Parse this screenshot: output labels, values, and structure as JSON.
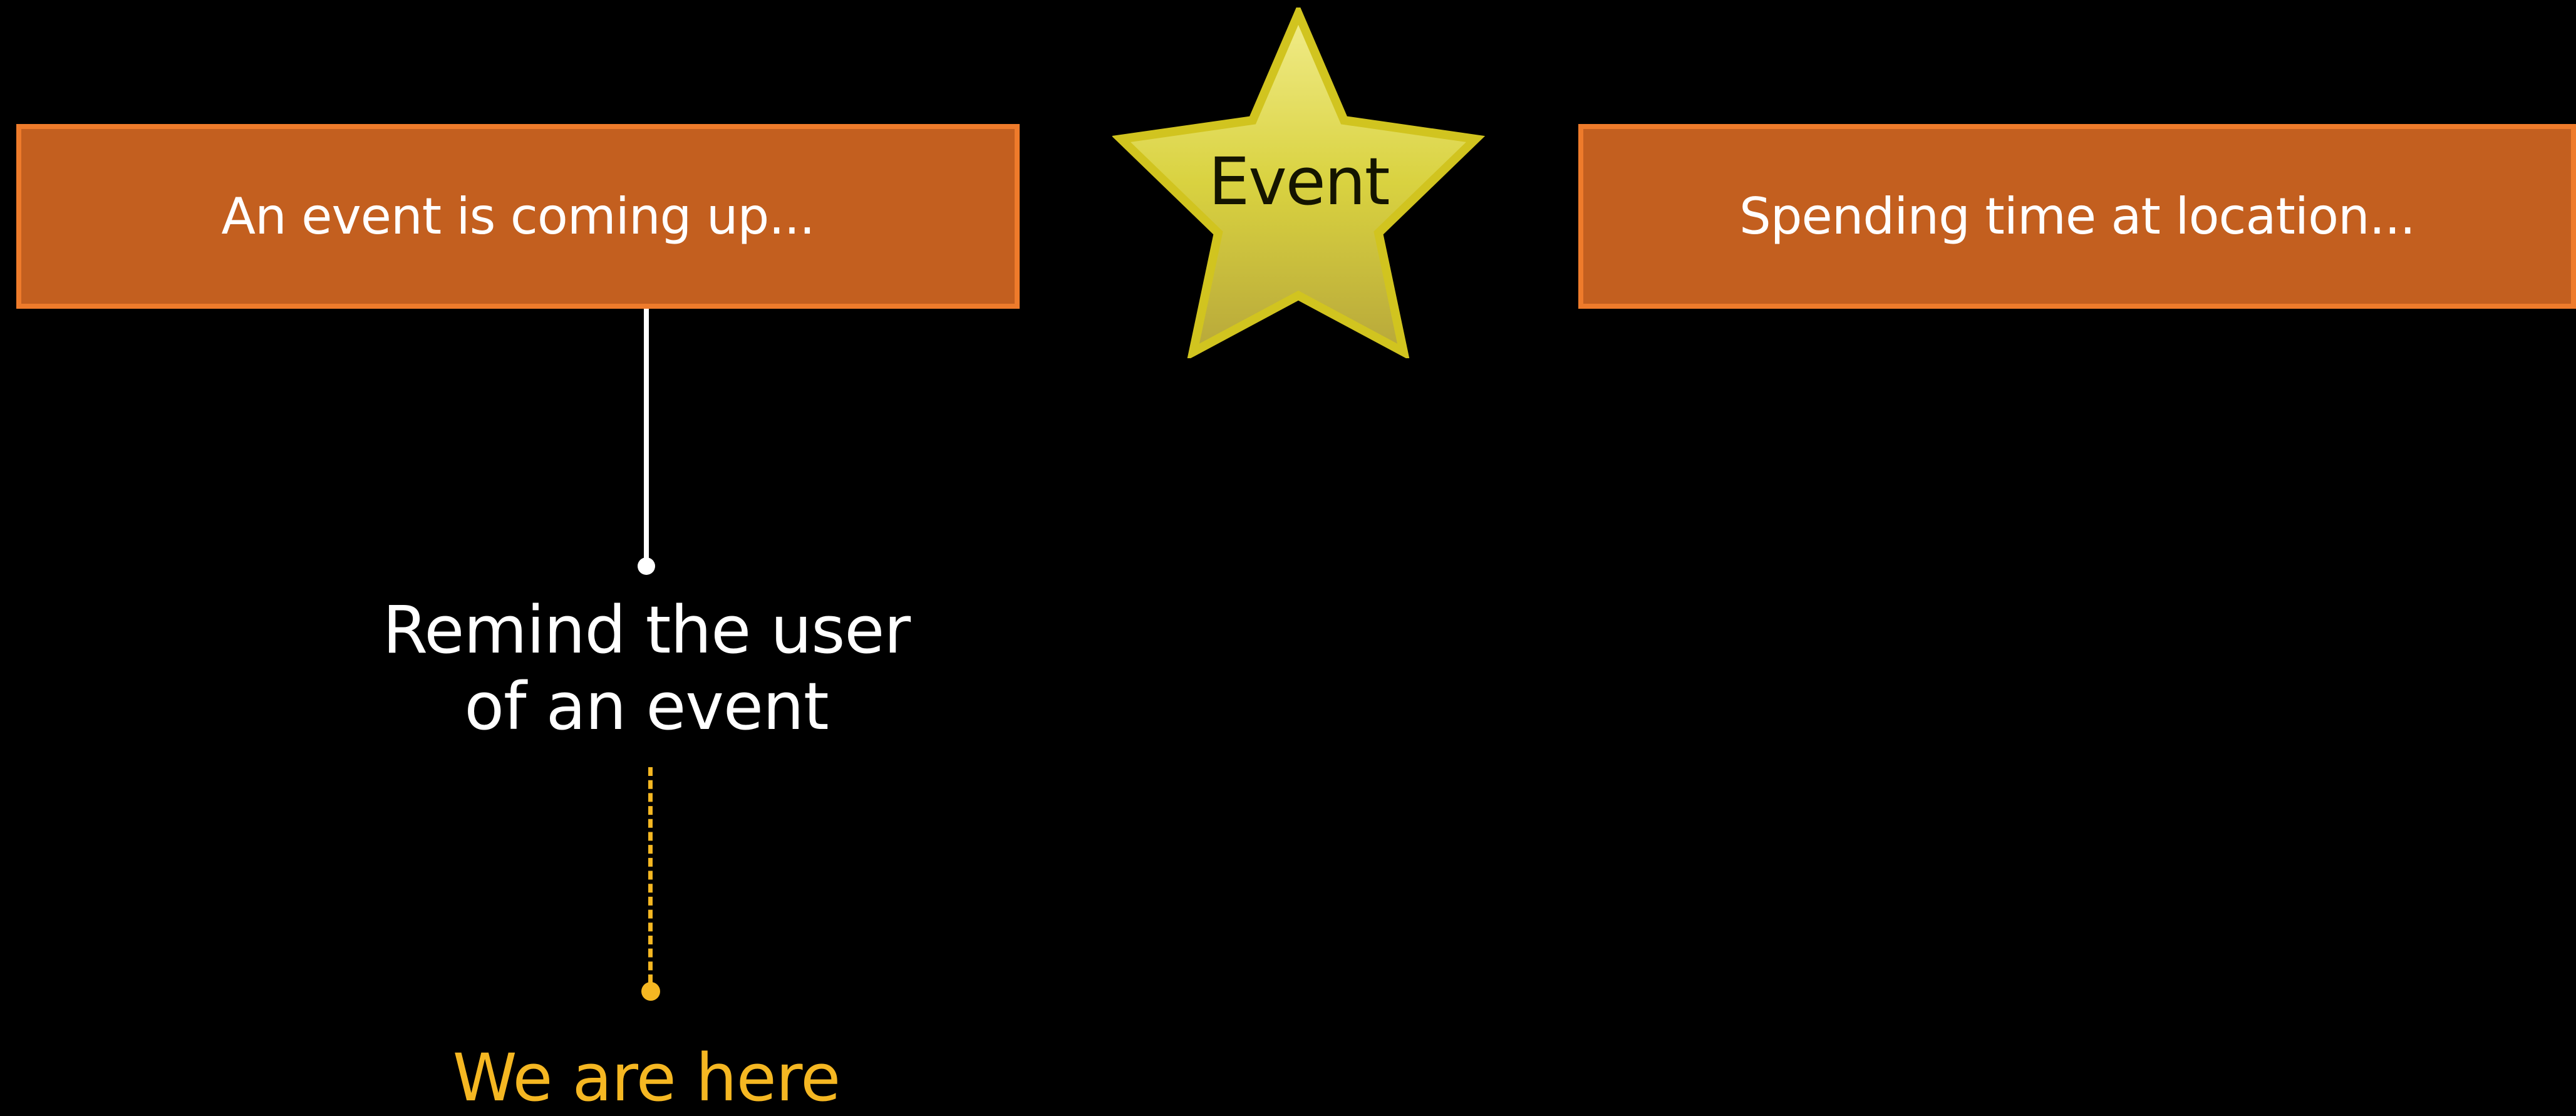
{
  "boxes": {
    "left_label": "An event is coming up...",
    "right_label": "Spending time at location..."
  },
  "star": {
    "label": "Event",
    "icon": "star-icon"
  },
  "reminder": {
    "line1": "Remind the user",
    "line2": "of an event"
  },
  "marker": {
    "label": "We are here"
  },
  "colors": {
    "background": "#000000",
    "box_fill": "#c35f1f",
    "box_border": "#ee7b2b",
    "star_fill": "#e2dc5a",
    "star_border": "#d1c41f",
    "accent_yellow": "#f5b722",
    "text_white": "#ffffff"
  }
}
